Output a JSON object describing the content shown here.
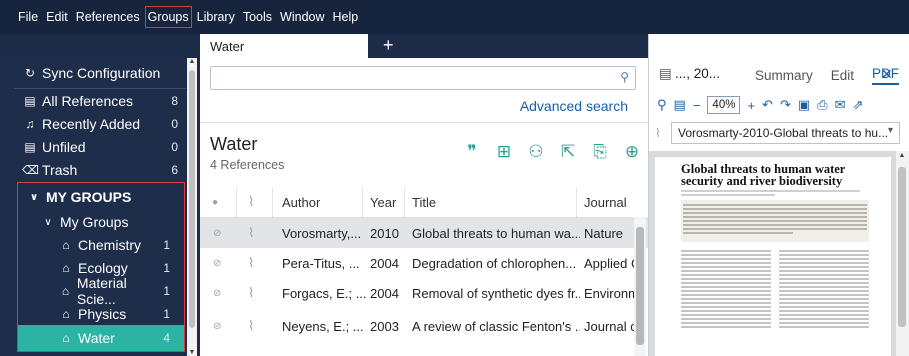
{
  "menu": {
    "items": [
      "File",
      "Edit",
      "References",
      "Groups",
      "Library",
      "Tools",
      "Window",
      "Help"
    ],
    "highlighted": "Groups"
  },
  "sidebar": {
    "sync": "Sync Configuration",
    "library": [
      {
        "label": "All References",
        "count": "8",
        "icon": "book-icon"
      },
      {
        "label": "Recently Added",
        "count": "0",
        "icon": "bell-icon"
      },
      {
        "label": "Unfiled",
        "count": "0",
        "icon": "book-icon"
      },
      {
        "label": "Trash",
        "count": "6",
        "icon": "trash-icon"
      }
    ],
    "my_groups_header": "MY GROUPS",
    "group_folder": "My Groups",
    "groups": [
      {
        "label": "Chemistry",
        "count": "1"
      },
      {
        "label": "Ecology",
        "count": "1"
      },
      {
        "label": "Material Scie...",
        "count": "1"
      },
      {
        "label": "Physics",
        "count": "1"
      },
      {
        "label": "Water",
        "count": "4"
      }
    ],
    "selected_group": "Water",
    "highlight_color": "#d53b3b",
    "selected_color": "#2bb3a3"
  },
  "center": {
    "tab_label": "Water",
    "tab_add": "+",
    "search_placeholder": "",
    "advanced_search": "Advanced search",
    "collection_title": "Water",
    "collection_subtitle": "4 References",
    "columns": [
      "Author",
      "Year",
      "Title",
      "Journal"
    ],
    "rows": [
      {
        "author": "Vorosmarty,...",
        "year": "2010",
        "title": "Global threats to human wa...",
        "journal": "Nature",
        "selected": true
      },
      {
        "author": "Pera-Titus, ...",
        "year": "2004",
        "title": "Degradation of chlorophen...",
        "journal": "Applied Cata",
        "selected": false
      },
      {
        "author": "Forgacs, E.; ...",
        "year": "2004",
        "title": "Removal of synthetic dyes fr...",
        "journal": "Environmen",
        "selected": false
      },
      {
        "author": "Neyens, E.; ...",
        "year": "2003",
        "title": "A review of classic Fenton's ...",
        "journal": "Journal of H",
        "selected": false
      }
    ],
    "tool_color": "#2aa093"
  },
  "right": {
    "ref_short": "..., 20...",
    "tabs": [
      "Summary",
      "Edit",
      "PDF"
    ],
    "active_tab": "PDF",
    "zoom": "40%",
    "file_name": "Vorosmarty-2010-Global threats to hu...",
    "pdf_title": "Global threats to human water security and river biodiversity",
    "link_color": "#1a5fa6"
  }
}
